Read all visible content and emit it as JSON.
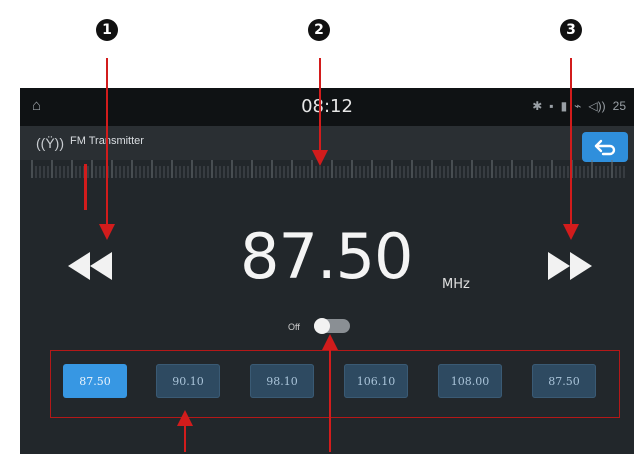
{
  "callouts": [
    "1",
    "2",
    "3"
  ],
  "status_bar": {
    "home_icon": "home-icon",
    "time": "08:12",
    "icons": [
      "bluetooth-icon",
      "sd-card-icon",
      "battery-icon",
      "usb-icon",
      "volume-icon"
    ],
    "volume_level": "25"
  },
  "title_bar": {
    "icon": "antenna-icon",
    "title": "FM Transmitter",
    "back_icon": "back-arrow-icon"
  },
  "tuner": {
    "frequency": "87.50",
    "unit": "MHz",
    "toggle_label": "Off",
    "toggle_on": false
  },
  "presets": [
    {
      "label": "87.50",
      "active": true
    },
    {
      "label": "90.10",
      "active": false
    },
    {
      "label": "98.10",
      "active": false
    },
    {
      "label": "106.10",
      "active": false
    },
    {
      "label": "108.00",
      "active": false
    },
    {
      "label": "87.50",
      "active": false
    }
  ],
  "colors": {
    "accent": "#2f8fdc",
    "callout_arrow": "#d21c1c",
    "screen_bg": "#22272b"
  }
}
